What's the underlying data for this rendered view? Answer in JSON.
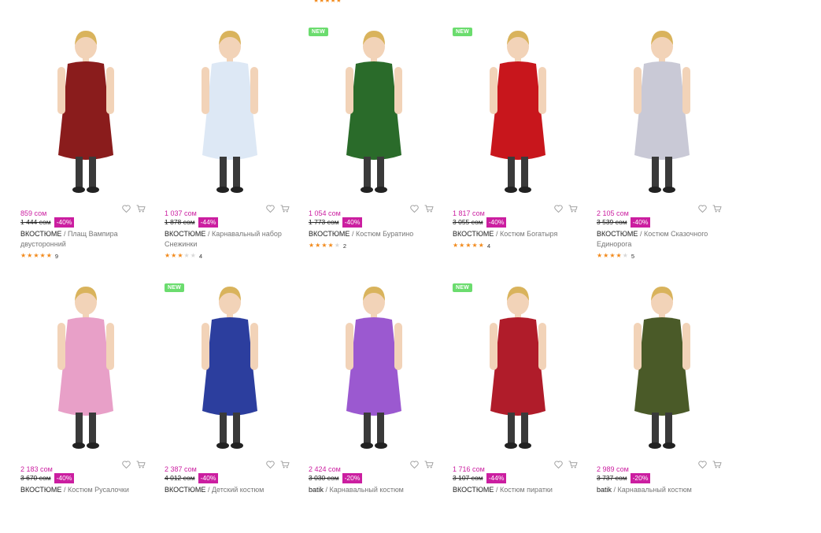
{
  "top_fragment": {
    "stars": "★★★★★"
  },
  "icons": {
    "favorite": "heart-icon",
    "cart": "cart-icon"
  },
  "products": [
    {
      "price": "859 сом",
      "old_price": "1 444 сом",
      "discount": "-40%",
      "brand": "ВКОСТЮМЕ",
      "name": "Плащ Вампира двусторонний",
      "rating": 5,
      "reviews": "9",
      "is_new": false,
      "new_label": ""
    },
    {
      "price": "1 037 сом",
      "old_price": "1 878 сом",
      "discount": "-44%",
      "brand": "ВКОСТЮМЕ",
      "name": "Карнавальный набор Снежинки",
      "rating": 3,
      "reviews": "4",
      "is_new": false,
      "new_label": ""
    },
    {
      "price": "1 054 сом",
      "old_price": "1 773 сом",
      "discount": "-40%",
      "brand": "ВКОСТЮМЕ",
      "name": "Костюм Буратино",
      "rating": 4,
      "reviews": "2",
      "is_new": true,
      "new_label": "NEW"
    },
    {
      "price": "1 817 сом",
      "old_price": "3 055 сом",
      "discount": "-40%",
      "brand": "ВКОСТЮМЕ",
      "name": "Костюм Богатыря",
      "rating": 5,
      "reviews": "4",
      "is_new": true,
      "new_label": "NEW"
    },
    {
      "price": "2 105 сом",
      "old_price": "3 539 сом",
      "discount": "-40%",
      "brand": "ВКОСТЮМЕ",
      "name": "Костюм Сказочного Единорога",
      "rating": 4,
      "reviews": "5",
      "is_new": false,
      "new_label": ""
    },
    {
      "price": "2 183 сом",
      "old_price": "3 670 сом",
      "discount": "-40%",
      "brand": "ВКОСТЮМЕ",
      "name": "Костюм Русалочки",
      "rating": 0,
      "reviews": "",
      "is_new": false,
      "new_label": ""
    },
    {
      "price": "2 387 сом",
      "old_price": "4 012 сом",
      "discount": "-40%",
      "brand": "ВКОСТЮМЕ",
      "name": "Детский костюм",
      "rating": 0,
      "reviews": "",
      "is_new": true,
      "new_label": "NEW"
    },
    {
      "price": "2 424 сом",
      "old_price": "3 030 сом",
      "discount": "-20%",
      "brand": "batik",
      "name": "Карнавальный костюм",
      "rating": 0,
      "reviews": "",
      "is_new": false,
      "new_label": ""
    },
    {
      "price": "1 716 сом",
      "old_price": "3 107 сом",
      "discount": "-44%",
      "brand": "ВКОСТЮМЕ",
      "name": "Костюм пиратки",
      "rating": 0,
      "reviews": "",
      "is_new": true,
      "new_label": "NEW"
    },
    {
      "price": "2 989 сом",
      "old_price": "3 737 сом",
      "discount": "-20%",
      "brand": "batik",
      "name": "Карнавальный костюм",
      "rating": 0,
      "reviews": "",
      "is_new": false,
      "new_label": ""
    }
  ],
  "costume_colors": [
    "#8a1c1c",
    "#dde8f5",
    "#2a6b2a",
    "#c8161c",
    "#c9c9d6",
    "#e8a0c8",
    "#2c3e9e",
    "#9b59d0",
    "#b01c2a",
    "#4a5a28"
  ]
}
